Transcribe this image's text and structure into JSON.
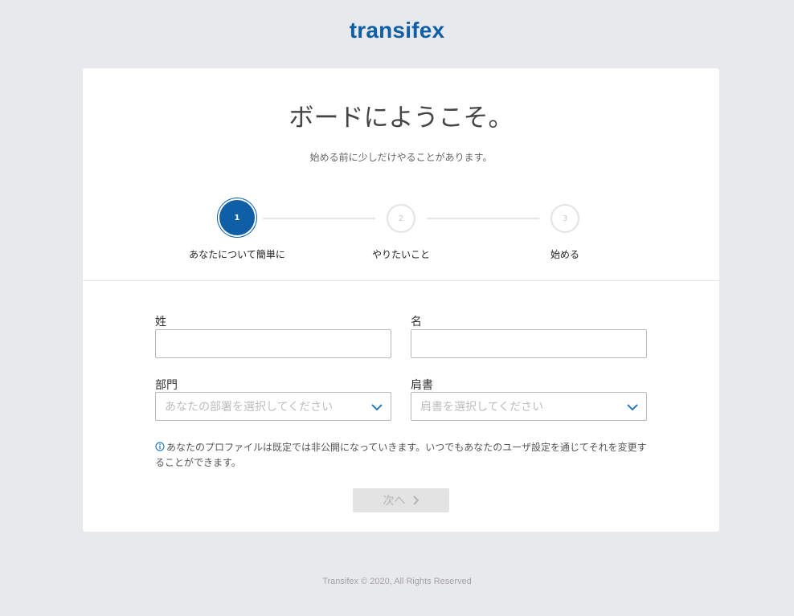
{
  "brand": {
    "logo_text": "transifex",
    "accent_color": "#0f5fa6"
  },
  "card": {
    "title": "ボードにようこそ。",
    "subtitle": "始める前に少しだけやることがあります。"
  },
  "stepper": {
    "steps": [
      {
        "number": "1",
        "label": "あなたについて簡単に",
        "state": "active"
      },
      {
        "number": "2",
        "label": "やりたいこと",
        "state": "inactive"
      },
      {
        "number": "3",
        "label": "始める",
        "state": "inactive"
      }
    ]
  },
  "form": {
    "last_name": {
      "label": "姓",
      "value": ""
    },
    "first_name": {
      "label": "名",
      "value": ""
    },
    "department": {
      "label": "部門",
      "placeholder": "あなたの部署を選択してください"
    },
    "job_title": {
      "label": "肩書",
      "placeholder": "肩書を選択してください"
    },
    "info_text": "あなたのプロファイルは既定では非公開になっていきます。いつでもあなたのユーザ設定を通じてそれを変更することができます。",
    "next_label": "次へ"
  },
  "footer": {
    "text": "Transifex © 2020, All Rights Reserved"
  }
}
